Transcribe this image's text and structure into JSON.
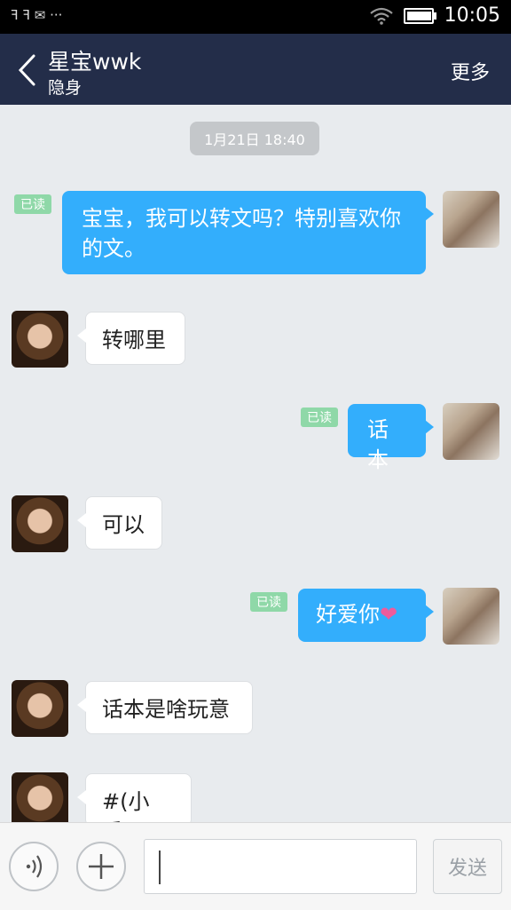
{
  "status_bar": {
    "left_icons_text": "ꟻ ꟻ ✉ ···",
    "time": "10:05",
    "battery_level": 0.9
  },
  "header": {
    "title": "星宝wwk",
    "subtitle": "隐身",
    "more_label": "更多"
  },
  "chat": {
    "timestamp": "1月21日 18:40",
    "read_label": "已读",
    "messages": [
      {
        "from": "me",
        "text": "宝宝，我可以转文吗？特别喜欢你的文。",
        "read": true
      },
      {
        "from": "other",
        "text": "转哪里"
      },
      {
        "from": "me",
        "text": "话本",
        "read": true
      },
      {
        "from": "other",
        "text": "可以"
      },
      {
        "from": "me",
        "text": "好爱你",
        "emoji": "❤",
        "read": true
      },
      {
        "from": "other",
        "text": "话本是啥玩意"
      },
      {
        "from": "other",
        "text": "#(小乖)"
      }
    ]
  },
  "input_bar": {
    "send_label": "发送",
    "input_value": "",
    "voice_icon": "voice-icon",
    "plus_icon": "plus-icon"
  },
  "colors": {
    "header_bg": "#232d49",
    "my_bubble": "#33aefc",
    "read_badge": "#8fd8a8",
    "page_bg": "#e8ebee"
  }
}
